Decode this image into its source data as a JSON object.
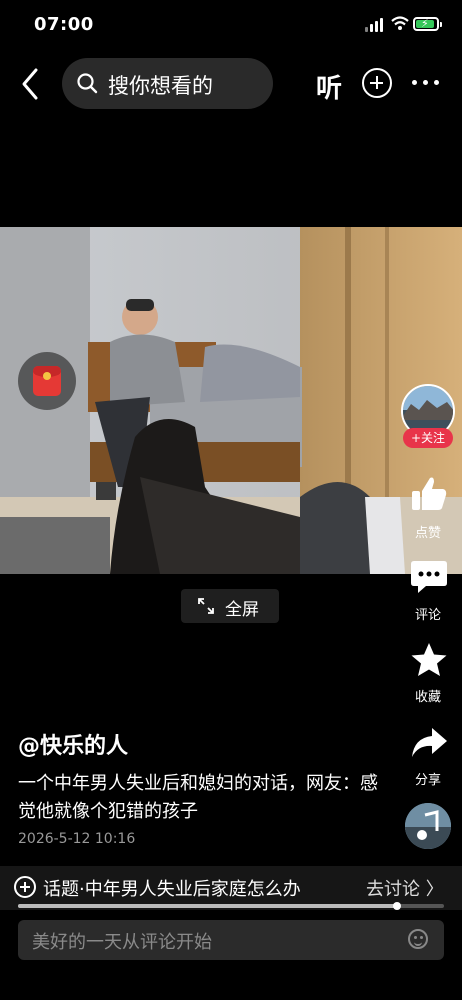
{
  "status_bar": {
    "time": "07:00",
    "battery_color": "#35c759"
  },
  "header": {
    "back_icon": "chevron-left-icon",
    "search_placeholder": "搜你想看的",
    "listen_label": "听",
    "add_icon": "plus-circle-icon",
    "more_icon": "more-dots-icon"
  },
  "video": {
    "red_packet_icon": "red-envelope-icon"
  },
  "right_rail": {
    "follow_label": "+关注",
    "like_label": "点赞",
    "comment_label": "评论",
    "favorite_label": "收藏",
    "share_label": "分享",
    "accent_color": "#e8344a"
  },
  "fullscreen": {
    "label": "全屏"
  },
  "caption": {
    "author": "@快乐的人",
    "description": "一个中年男人失业后和媳妇的对话，网友：感觉他就像个犯错的孩子",
    "date": "2026-5-12 10:16"
  },
  "topic": {
    "text": "话题·中年男人失业后家庭怎么办",
    "action": "去讨论 〉"
  },
  "progress": {
    "fraction": 0.89
  },
  "comment_input": {
    "placeholder": "美好的一天从评论开始"
  }
}
